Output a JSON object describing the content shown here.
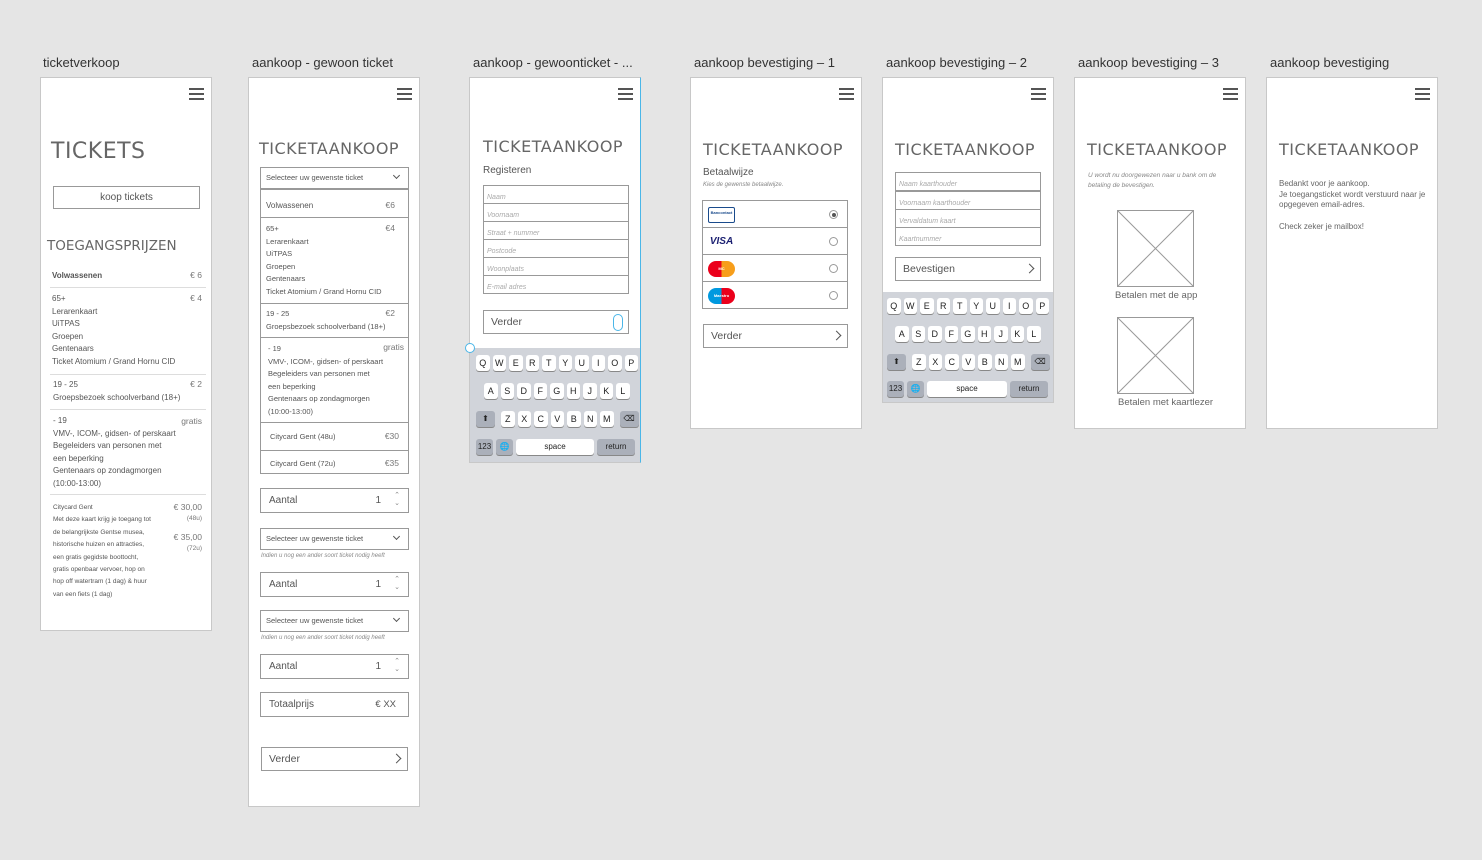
{
  "labels": [
    "ticketverkoop",
    "aankoop - gewoon ticket",
    "aankoop - gewoonticket - ...",
    "aankoop bevestiging – 1",
    "aankoop bevestiging – 2",
    "aankoop bevestiging – 3",
    "aankoop bevestiging"
  ],
  "a1": {
    "title": "TICKETS",
    "button": "koop tickets",
    "section": "TOEGANGSPRIJZEN",
    "rows": [
      {
        "text": "Volwassenen",
        "price": "€ 6"
      },
      {
        "text": "65+\nLerarenkaart\nUiTPAS\nGroepen\nGentenaars\nTicket Atomium / Grand Hornu CID",
        "price": "€ 4"
      },
      {
        "text": "19 - 25\nGroepsbezoek schoolverband (18+)",
        "price": "€ 2"
      },
      {
        "text": "- 19\nVMV-, ICOM-, gidsen- of perskaart\nBegeleiders van personen met\neen beperking\nGentenaars op zondagmorgen\n(10:00-13:00)",
        "price": "gratis"
      },
      {
        "text": "Citycard Gent\nMet deze kaart krijg je toegang tot\nde belangrijkste Gentse musea,\nhistorische huizen en attracties,\neen gratis gegidste boottocht,\ngratis openbaar vervoer, hop on\nhop off watertram (1 dag) & huur\nvan een fiets (1 dag)",
        "price": "€ 30,00",
        "sub1": "(48u)",
        "price2": "€ 35,00",
        "sub2": "(72u)"
      }
    ]
  },
  "a2": {
    "title": "TICKETAANKOOP",
    "select": "Selecteer uw gewenste ticket",
    "options": [
      {
        "text": "Volwassenen",
        "price": "€6"
      },
      {
        "text": "65+\nLerarenkaart\nUiTPAS\nGroepen\nGentenaars\nTicket Atomium / Grand Hornu CID",
        "price": "€4"
      },
      {
        "text": "19 - 25\nGroepsbezoek schoolverband (18+)",
        "price": "€2"
      },
      {
        "text": "- 19\nVMV-, ICOM-, gidsen- of perskaart\nBegeleiders van personen met\neen beperking\nGentenaars op zondagmorgen\n(10:00-13:00)",
        "price": "gratis"
      },
      {
        "text": "Citycard Gent (48u)",
        "price": "€30"
      },
      {
        "text": "Citycard Gent (72u)",
        "price": "€35"
      }
    ],
    "aantal": "Aantal",
    "qty": "1",
    "hint": "Indien u nog een ander soort ticket nodig heeft",
    "total_label": "Totaalprijs",
    "total_value": "€ XX",
    "next": "Verder"
  },
  "a3": {
    "title": "TICKETAANKOOP",
    "subtitle": "Registeren",
    "fields": [
      "Naam",
      "Voornaam",
      "Straat + nummer",
      "Postcode",
      "Woonplaats",
      "E-mail adres"
    ],
    "next": "Verder"
  },
  "keyboard": {
    "row1": [
      "Q",
      "W",
      "E",
      "R",
      "T",
      "Y",
      "U",
      "I",
      "O",
      "P"
    ],
    "row2": [
      "A",
      "S",
      "D",
      "F",
      "G",
      "H",
      "J",
      "K",
      "L"
    ],
    "row3": [
      "Z",
      "X",
      "C",
      "V",
      "B",
      "N",
      "M"
    ],
    "shift": "⬆",
    "backspace": "⌫",
    "num": "123",
    "globe": "🌐",
    "space": "space",
    "return": "return"
  },
  "a4": {
    "title": "TICKETAANKOOP",
    "subtitle": "Betaalwijze",
    "hint": "Kies de gewenste betaalwijze.",
    "methods": [
      {
        "logo": "Bancontact",
        "color": "#1a4b8c"
      },
      {
        "logo": "VISA",
        "color": "#1a1f71"
      },
      {
        "logo": "MC",
        "color": "#eb001b"
      },
      {
        "logo": "Maestro",
        "color": "#0099df"
      }
    ],
    "next": "Verder"
  },
  "a5": {
    "title": "TICKETAANKOOP",
    "fields": [
      "Naam kaarthouder",
      "Voornaam kaarthouder",
      "Vervaldatum kaart",
      "Kaartnummer"
    ],
    "confirm": "Bevestigen"
  },
  "a6": {
    "title": "TICKETAANKOOP",
    "note": "U wordt nu doorgewezen naar u bank om de betaling de bevestigen.",
    "opt1": "Betalen met de app",
    "opt2": "Betalen met kaartlezer"
  },
  "a7": {
    "title": "TICKETAANKOOP",
    "text1": "Bedankt voor je aankoop.",
    "text2": "Je toegangsticket wordt verstuurd naar je opgegeven email-adres.",
    "text3": "Check zeker je mailbox!"
  }
}
